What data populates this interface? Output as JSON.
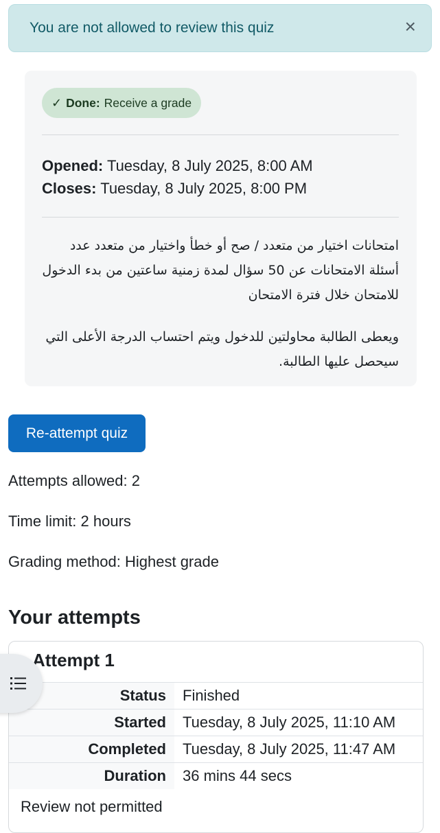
{
  "alert": {
    "message": "You are not allowed to review this quiz",
    "close_glyph": "×"
  },
  "activity": {
    "completion_label": "Done:",
    "completion_text": "Receive a grade",
    "opened_label": "Opened:",
    "opened_value": "Tuesday, 8 July 2025, 8:00 AM",
    "closes_label": "Closes:",
    "closes_value": "Tuesday, 8 July 2025, 8:00 PM",
    "description_p1": "امتحانات اختيار من متعدد / صح أو خطأ واختيار من متعدد عدد أسئلة الامتحانات عن 50 سؤال لمدة زمنية ساعتين من بدء الدخول للامتحان خلال فترة الامتحان",
    "description_p2": "ويعطى الطالبة محاولتين للدخول ويتم احتساب الدرجة الأعلى التي سيحصل عليها الطالبة."
  },
  "reattempt_button": "Re-attempt quiz",
  "quiz_info": {
    "attempts_allowed": "Attempts allowed: 2",
    "time_limit": "Time limit: 2 hours",
    "grading_method": "Grading method: Highest grade"
  },
  "attempts_heading": "Your attempts",
  "attempt": {
    "title": "Attempt 1",
    "rows": [
      {
        "label": "Status",
        "value": "Finished"
      },
      {
        "label": "Started",
        "value": "Tuesday, 8 July 2025, 11:10 AM"
      },
      {
        "label": "Completed",
        "value": "Tuesday, 8 July 2025, 11:47 AM"
      },
      {
        "label": "Duration",
        "value": "36 mins 44 secs"
      }
    ],
    "review_text": "Review not permitted"
  },
  "icons": {
    "alert_close": "close-icon",
    "completion": "check-icon",
    "drawer": "list-icon"
  },
  "colors": {
    "primary": "#0f6cbf",
    "alert_bg": "#cfe8ea",
    "alert_text": "#115a66",
    "badge_bg": "#cfe5d4"
  }
}
